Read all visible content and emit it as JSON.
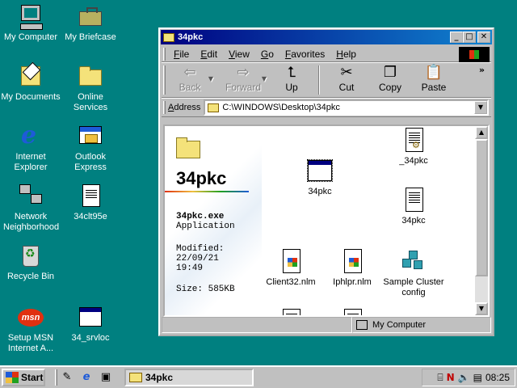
{
  "desktop": {
    "icons": [
      {
        "label": "My Computer"
      },
      {
        "label": "My Briefcase"
      },
      {
        "label": "My Documents"
      },
      {
        "label": "Online Services"
      },
      {
        "label": "Internet Explorer"
      },
      {
        "label": "Outlook Express"
      },
      {
        "label": "Network Neighborhood"
      },
      {
        "label": "34clt95e"
      },
      {
        "label": "Recycle Bin"
      },
      {
        "label": "Setup MSN Internet A..."
      },
      {
        "label": "34_srvloc"
      }
    ]
  },
  "window": {
    "title": "34pkc",
    "menu": [
      "File",
      "Edit",
      "View",
      "Go",
      "Favorites",
      "Help"
    ],
    "toolbar": {
      "back": "Back",
      "forward": "Forward",
      "up": "Up",
      "cut": "Cut",
      "copy": "Copy",
      "paste": "Paste"
    },
    "address": {
      "label": "Address",
      "value": "C:\\WINDOWS\\Desktop\\34pkc"
    },
    "info": {
      "folder_title": "34pkc",
      "file_name": "34pkc.exe",
      "file_type": "Application",
      "modified_label": "Modified:",
      "modified_date": "22/09/21",
      "modified_time": "19:49",
      "size": "Size: 585KB"
    },
    "files": [
      {
        "label": "_34pkc"
      },
      {
        "label": "34pkc"
      },
      {
        "label": "34pkc"
      },
      {
        "label": "Client32.nlm"
      },
      {
        "label": "Iphlpr.nlm"
      },
      {
        "label": "Sample Cluster config"
      }
    ],
    "status": {
      "location": "My Computer"
    }
  },
  "taskbar": {
    "start_label": "Start",
    "task_label": "34pkc",
    "clock": "08:25"
  }
}
